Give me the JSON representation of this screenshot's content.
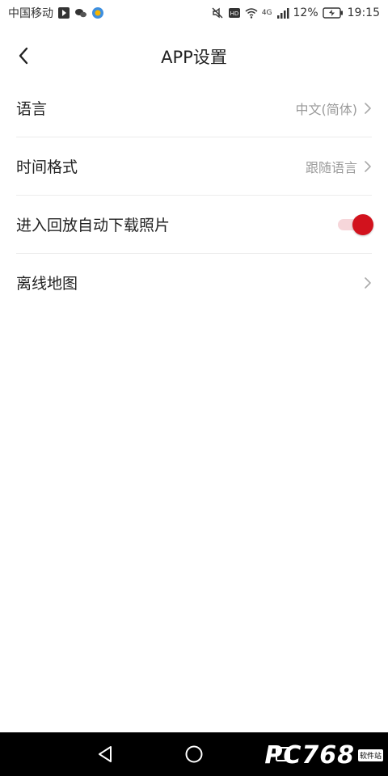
{
  "status_bar": {
    "carrier": "中国移动",
    "network": "4G",
    "battery": "12%",
    "time": "19:15"
  },
  "header": {
    "title": "APP设置"
  },
  "settings": {
    "items": [
      {
        "label": "语言",
        "value": "中文(简体)"
      },
      {
        "label": "时间格式",
        "value": "跟随语言"
      },
      {
        "label": "进入回放自动下载照片",
        "toggle_on": true
      },
      {
        "label": "离线地图",
        "value": ""
      }
    ]
  },
  "watermark": {
    "text": "PC768",
    "sub": "软件站"
  },
  "colors": {
    "accent": "#d2121d",
    "toggle_track": "#f6d6da",
    "secondary_text": "#9a9a9a",
    "divider": "#ececec"
  }
}
